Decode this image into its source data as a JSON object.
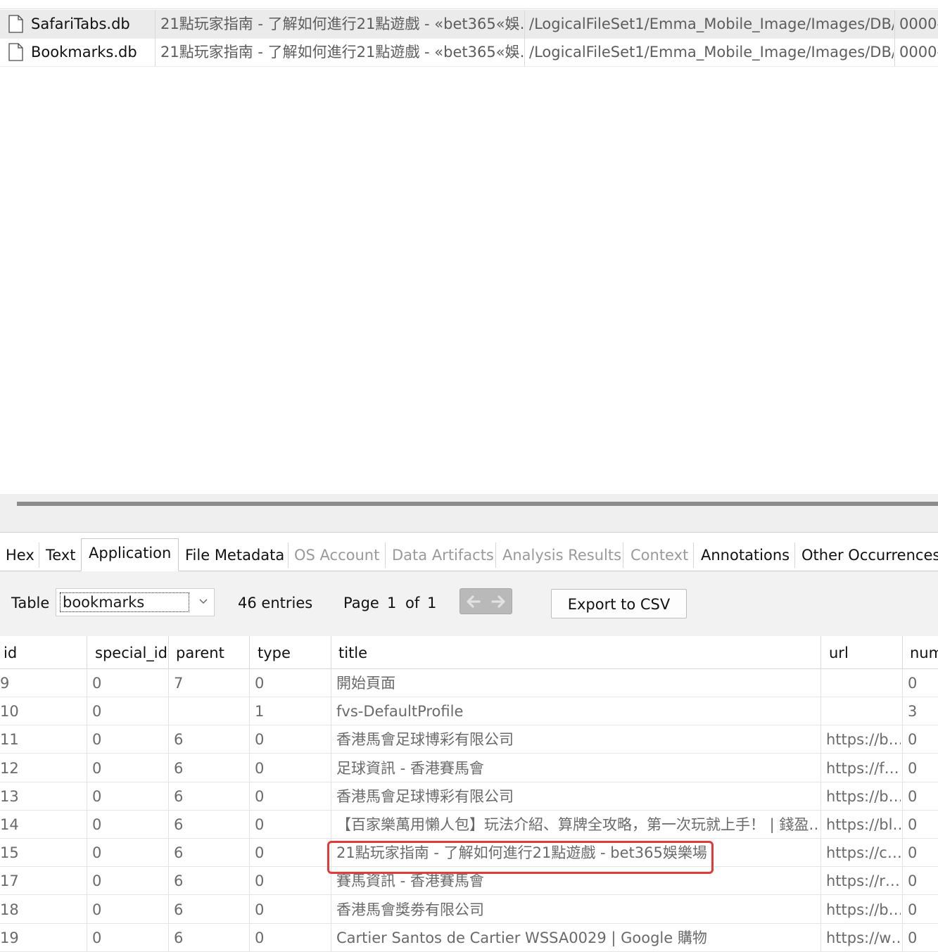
{
  "file_list": [
    {
      "name": "SafariTabs.db",
      "snippet": "21點玩家指南 - 了解如何進行21點遊戲 - «bet365«娛…",
      "path": "/LogicalFileSet1/Emma_Mobile_Image/Images/DB/...",
      "size": "0000-",
      "selected": true
    },
    {
      "name": "Bookmarks.db",
      "snippet": "21點玩家指南 - 了解如何進行21點遊戲 - «bet365«娛…",
      "path": "/LogicalFileSet1/Emma_Mobile_Image/Images/DB/...",
      "size": "0000-",
      "selected": false
    }
  ],
  "tabs": [
    {
      "label": "Hex",
      "state": "normal"
    },
    {
      "label": "Text",
      "state": "normal"
    },
    {
      "label": "Application",
      "state": "active"
    },
    {
      "label": "File Metadata",
      "state": "normal"
    },
    {
      "label": "OS Account",
      "state": "disabled"
    },
    {
      "label": "Data Artifacts",
      "state": "disabled"
    },
    {
      "label": "Analysis Results",
      "state": "disabled"
    },
    {
      "label": "Context",
      "state": "disabled"
    },
    {
      "label": "Annotations",
      "state": "normal"
    },
    {
      "label": "Other Occurrences",
      "state": "normal"
    }
  ],
  "toolbar": {
    "table_label": "Table",
    "table_selected": "bookmarks",
    "entries": "46 entries",
    "page_label": "Page",
    "page_current": "1",
    "page_of": "of",
    "page_total": "1",
    "export_label": "Export to CSV"
  },
  "table": {
    "columns": [
      "id",
      "special_id",
      "parent",
      "type",
      "title",
      "url",
      "num"
    ],
    "rows": [
      [
        "9",
        "0",
        "7",
        "0",
        "開始頁面",
        "",
        "0"
      ],
      [
        "10",
        "0",
        "",
        "1",
        "fvs-DefaultProfile",
        "",
        "3"
      ],
      [
        "11",
        "0",
        "6",
        "0",
        "香港馬會足球博彩有限公司",
        "https://b…",
        "0"
      ],
      [
        "12",
        "0",
        "6",
        "0",
        "足球資訊 - 香港賽馬會",
        "https://f…",
        "0"
      ],
      [
        "13",
        "0",
        "6",
        "0",
        "香港馬會足球博彩有限公司",
        "https://b…",
        "0"
      ],
      [
        "14",
        "0",
        "6",
        "0",
        "【百家樂萬用懶人包】玩法介紹、算牌全攻略，第一次玩就上手！ | 錢盈…",
        "https://bl…",
        "0"
      ],
      [
        "15",
        "0",
        "6",
        "0",
        "21點玩家指南 - 了解如何進行21點遊戲 - bet365娛樂場",
        "https://c…",
        "0"
      ],
      [
        "17",
        "0",
        "6",
        "0",
        "賽馬資訊 - 香港賽馬會",
        "https://r…",
        "0"
      ],
      [
        "18",
        "0",
        "6",
        "0",
        "香港馬會獎劵有限公司",
        "https://b…",
        "0"
      ],
      [
        "19",
        "0",
        "6",
        "0",
        "Cartier Santos de Cartier WSSA0029 | Google 購物",
        "https://w…",
        "0"
      ]
    ],
    "highlighted_row_id": "15"
  },
  "colors": {
    "highlight_border": "#e03b3b",
    "selected_row": "#ebebeb",
    "toolbar_bg": "#f2f2f2",
    "disabled_text": "#9a9a9a"
  }
}
